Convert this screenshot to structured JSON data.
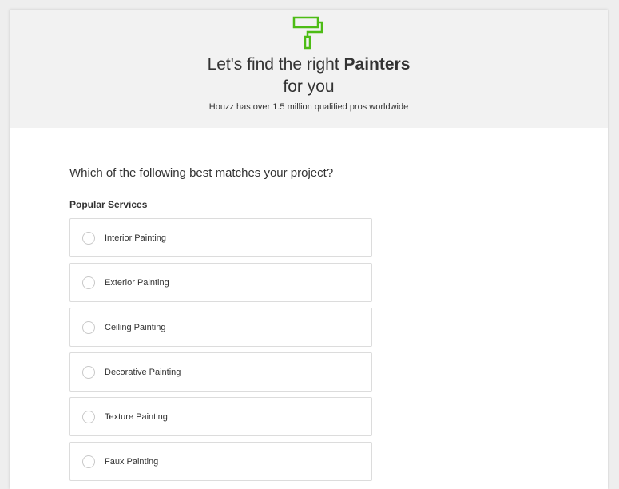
{
  "header": {
    "icon": "paint-roller-icon",
    "accent_color": "#4dbc15",
    "headline_prefix": "Let's find the right ",
    "headline_category": "Painters",
    "headline_suffix": "for you",
    "subhead": "Houzz has over 1.5 million qualified pros worldwide"
  },
  "form": {
    "question": "Which of the following best matches your project?",
    "section_label": "Popular Services",
    "options": [
      {
        "label": "Interior Painting",
        "selected": false
      },
      {
        "label": "Exterior Painting",
        "selected": false
      },
      {
        "label": "Ceiling Painting",
        "selected": false
      },
      {
        "label": "Decorative Painting",
        "selected": false
      },
      {
        "label": "Texture Painting",
        "selected": false
      },
      {
        "label": "Faux Painting",
        "selected": false
      }
    ]
  }
}
